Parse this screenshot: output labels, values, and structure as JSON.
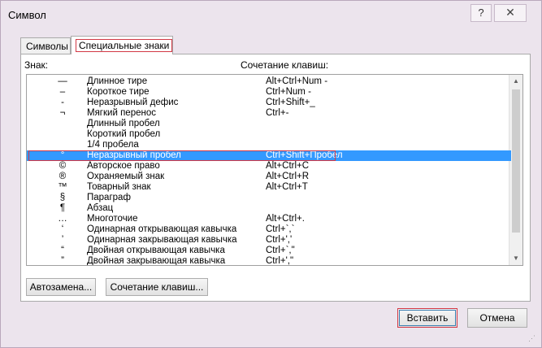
{
  "window": {
    "title": "Символ"
  },
  "titlebar": {
    "help_label": "?",
    "close_label": "✕"
  },
  "tabs": [
    {
      "label": "Символы"
    },
    {
      "label": "Специальные знаки"
    }
  ],
  "columns": {
    "symbol": "Знак:",
    "shortcut": "Сочетание клавиш:"
  },
  "rows": [
    {
      "symbol": "—",
      "name": "Длинное тире",
      "keys": "Alt+Ctrl+Num -"
    },
    {
      "symbol": "–",
      "name": "Короткое тире",
      "keys": "Ctrl+Num -"
    },
    {
      "symbol": "-",
      "name": "Неразрывный дефис",
      "keys": "Ctrl+Shift+_"
    },
    {
      "symbol": "¬",
      "name": "Мягкий перенос",
      "keys": "Ctrl+-"
    },
    {
      "symbol": "",
      "name": "Длинный пробел",
      "keys": ""
    },
    {
      "symbol": "",
      "name": "Короткий пробел",
      "keys": ""
    },
    {
      "symbol": "",
      "name": "1/4 пробела",
      "keys": ""
    },
    {
      "symbol": "°",
      "name": "Неразрывный пробел",
      "keys": "Ctrl+Shift+Пробел",
      "selected": true
    },
    {
      "symbol": "©",
      "name": "Авторское право",
      "keys": "Alt+Ctrl+C"
    },
    {
      "symbol": "®",
      "name": "Охраняемый знак",
      "keys": "Alt+Ctrl+R"
    },
    {
      "symbol": "™",
      "name": "Товарный знак",
      "keys": "Alt+Ctrl+T"
    },
    {
      "symbol": "§",
      "name": "Параграф",
      "keys": ""
    },
    {
      "symbol": "¶",
      "name": "Абзац",
      "keys": ""
    },
    {
      "symbol": "…",
      "name": "Многоточие",
      "keys": "Alt+Ctrl+."
    },
    {
      "symbol": "‘",
      "name": "Одинарная открывающая кавычка",
      "keys": "Ctrl+`,`"
    },
    {
      "symbol": "’",
      "name": "Одинарная закрывающая кавычка",
      "keys": "Ctrl+','"
    },
    {
      "symbol": "“",
      "name": "Двойная открывающая кавычка",
      "keys": "Ctrl+`,\""
    },
    {
      "symbol": "”",
      "name": "Двойная закрывающая кавычка",
      "keys": "Ctrl+',\""
    }
  ],
  "buttons": {
    "autocorrect": "Автозамена...",
    "shortcut": "Сочетание клавиш...",
    "insert": "Вставить",
    "cancel": "Отмена"
  },
  "colors": {
    "selection": "#3399ff",
    "highlight_border": "#d23845",
    "window_bg": "#ece4ed"
  }
}
